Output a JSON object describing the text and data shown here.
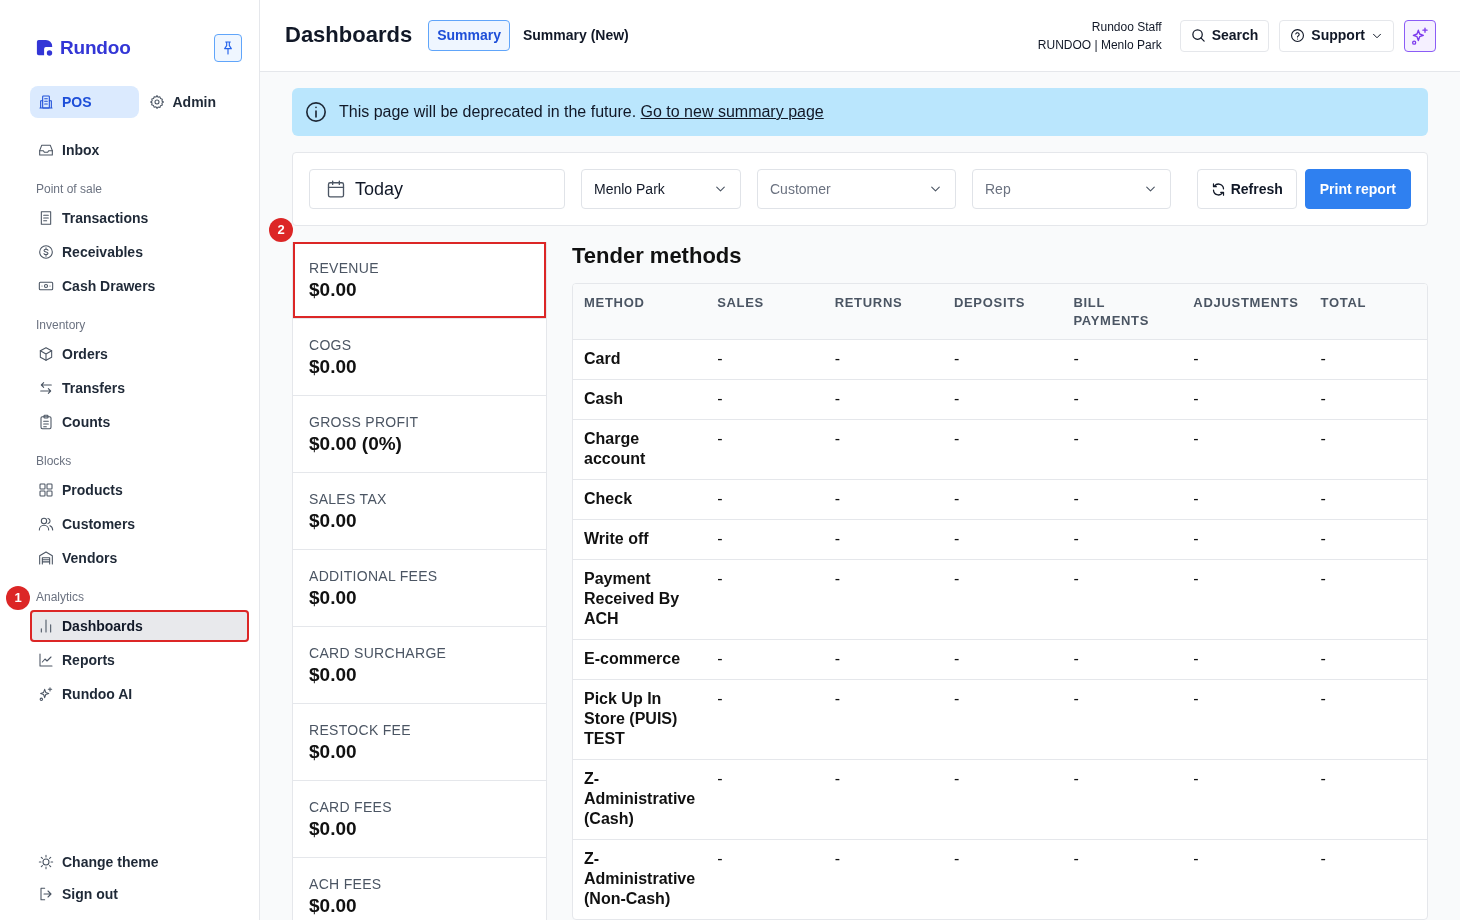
{
  "sidebar": {
    "logo": "Rundoo",
    "modes": [
      {
        "label": "POS",
        "selected": true
      },
      {
        "label": "Admin",
        "selected": false
      }
    ],
    "sections": [
      {
        "items": [
          {
            "label": "Inbox",
            "selected": false
          }
        ]
      },
      {
        "heading": "Point of sale",
        "items": [
          {
            "label": "Transactions",
            "selected": false
          },
          {
            "label": "Receivables",
            "selected": false
          },
          {
            "label": "Cash Drawers",
            "selected": false
          }
        ]
      },
      {
        "heading": "Inventory",
        "items": [
          {
            "label": "Orders",
            "selected": false
          },
          {
            "label": "Transfers",
            "selected": false
          },
          {
            "label": "Counts",
            "selected": false
          }
        ]
      },
      {
        "heading": "Blocks",
        "items": [
          {
            "label": "Products",
            "selected": false
          },
          {
            "label": "Customers",
            "selected": false
          },
          {
            "label": "Vendors",
            "selected": false
          }
        ]
      },
      {
        "heading": "Analytics",
        "items": [
          {
            "label": "Dashboards",
            "selected": true,
            "callout": "1"
          },
          {
            "label": "Reports",
            "selected": false
          },
          {
            "label": "Rundoo AI",
            "selected": false
          }
        ]
      }
    ],
    "footer": [
      {
        "label": "Change theme"
      },
      {
        "label": "Sign out"
      }
    ]
  },
  "header": {
    "title": "Dashboards",
    "tabs": [
      {
        "label": "Summary",
        "selected": true
      },
      {
        "label": "Summary (New)",
        "selected": false
      }
    ],
    "user": {
      "name": "Rundoo Staff",
      "store": "RUNDOO | Menlo Park"
    },
    "search_button": "Search",
    "support_button": "Support"
  },
  "alert": {
    "message": "This page will be deprecated in the future.",
    "link": "Go to new summary page"
  },
  "filters": {
    "fields": [
      {
        "kind": "date",
        "value": "Today"
      },
      {
        "kind": "select",
        "value": "Menlo Park"
      },
      {
        "kind": "select",
        "placeholder": "Customer"
      },
      {
        "kind": "select",
        "placeholder": "Rep"
      }
    ],
    "buttons": [
      {
        "label": "Refresh",
        "kind": "secondary"
      },
      {
        "label": "Print report",
        "kind": "primary"
      }
    ]
  },
  "metrics": [
    {
      "label": "REVENUE",
      "value": "$0.00",
      "callout": "2"
    },
    {
      "label": "COGS",
      "value": "$0.00"
    },
    {
      "label": "GROSS PROFIT",
      "value": "$0.00 (0%)"
    },
    {
      "label": "SALES TAX",
      "value": "$0.00"
    },
    {
      "label": "ADDITIONAL FEES",
      "value": "$0.00"
    },
    {
      "label": "CARD SURCHARGE",
      "value": "$0.00"
    },
    {
      "label": "RESTOCK FEE",
      "value": "$0.00"
    },
    {
      "label": "CARD FEES",
      "value": "$0.00"
    },
    {
      "label": "ACH FEES",
      "value": "$0.00"
    }
  ],
  "tender_methods": {
    "title": "Tender methods",
    "columns": [
      "METHOD",
      "SALES",
      "RETURNS",
      "DEPOSITS",
      "BILL PAYMENTS",
      "ADJUSTMENTS",
      "TOTAL"
    ],
    "rows": [
      [
        "Card",
        "-",
        "-",
        "-",
        "-",
        "-",
        "-"
      ],
      [
        "Cash",
        "-",
        "-",
        "-",
        "-",
        "-",
        "-"
      ],
      [
        "Charge account",
        "-",
        "-",
        "-",
        "-",
        "-",
        "-"
      ],
      [
        "Check",
        "-",
        "-",
        "-",
        "-",
        "-",
        "-"
      ],
      [
        "Write off",
        "-",
        "-",
        "-",
        "-",
        "-",
        "-"
      ],
      [
        "Payment Received By ACH",
        "-",
        "-",
        "-",
        "-",
        "-",
        "-"
      ],
      [
        "E-commerce",
        "-",
        "-",
        "-",
        "-",
        "-",
        "-"
      ],
      [
        "Pick Up In Store (PUIS) TEST",
        "-",
        "-",
        "-",
        "-",
        "-",
        "-"
      ],
      [
        "Z-Administrative (Cash)",
        "-",
        "-",
        "-",
        "-",
        "-",
        "-"
      ],
      [
        "Z-Administrative (Non-Cash)",
        "-",
        "-",
        "-",
        "-",
        "-",
        "-"
      ]
    ]
  }
}
